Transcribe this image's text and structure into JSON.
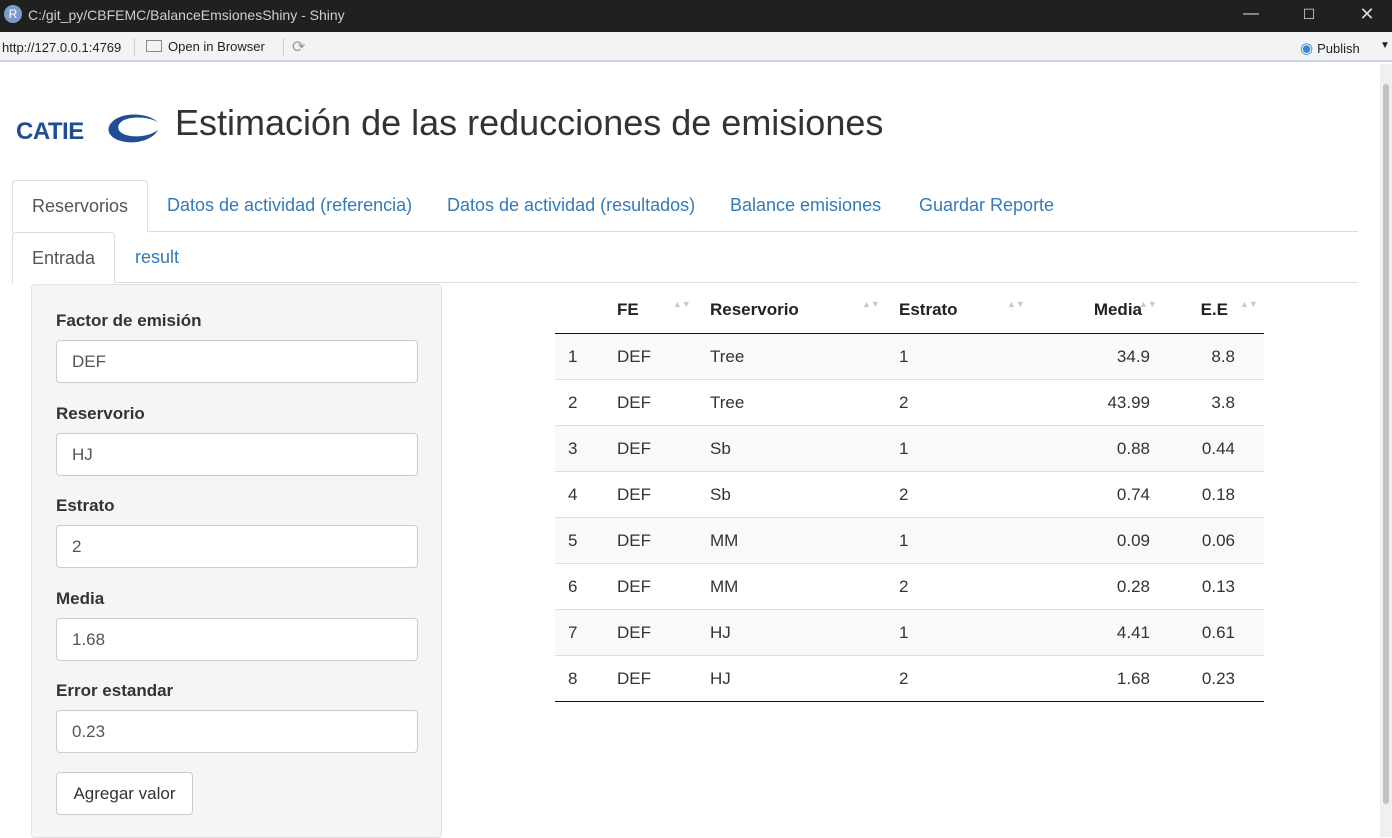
{
  "window": {
    "icon_letter": "R",
    "title": "C:/git_py/CBFEMC/BalanceEmsionesShiny - Shiny",
    "minimize": "—",
    "maximize": "☐",
    "close": "✕"
  },
  "toolbar": {
    "url": "http://127.0.0.1:4769",
    "open_browser": "Open in Browser",
    "refresh": "⟳",
    "publish_icon": "◉",
    "publish": "Publish",
    "dropdown": "▼"
  },
  "header": {
    "logo_text": "CATIE",
    "logo_color": "#1f4e96",
    "title": "Estimación de las reducciones de emisiones"
  },
  "main_tabs": [
    {
      "label": "Reservorios",
      "active": true
    },
    {
      "label": "Datos de actividad (referencia)",
      "active": false
    },
    {
      "label": "Datos de actividad (resultados)",
      "active": false
    },
    {
      "label": "Balance emisiones",
      "active": false
    },
    {
      "label": "Guardar Reporte",
      "active": false
    }
  ],
  "sub_tabs": [
    {
      "label": "Entrada",
      "active": true
    },
    {
      "label": "result",
      "active": false
    }
  ],
  "form": {
    "factor": {
      "label": "Factor de emisión",
      "value": "DEF"
    },
    "reservorio": {
      "label": "Reservorio",
      "value": "HJ"
    },
    "estrato": {
      "label": "Estrato",
      "value": "2"
    },
    "media": {
      "label": "Media",
      "value": "1.68"
    },
    "error": {
      "label": "Error estandar",
      "value": "0.23"
    },
    "submit": "Agregar valor"
  },
  "table": {
    "columns": [
      "",
      "FE",
      "Reservorio",
      "Estrato",
      "Media",
      "E.E"
    ],
    "rows": [
      [
        "1",
        "DEF",
        "Tree",
        "1",
        "34.9",
        "8.8"
      ],
      [
        "2",
        "DEF",
        "Tree",
        "2",
        "43.99",
        "3.8"
      ],
      [
        "3",
        "DEF",
        "Sb",
        "1",
        "0.88",
        "0.44"
      ],
      [
        "4",
        "DEF",
        "Sb",
        "2",
        "0.74",
        "0.18"
      ],
      [
        "5",
        "DEF",
        "MM",
        "1",
        "0.09",
        "0.06"
      ],
      [
        "6",
        "DEF",
        "MM",
        "2",
        "0.28",
        "0.13"
      ],
      [
        "7",
        "DEF",
        "HJ",
        "1",
        "4.41",
        "0.61"
      ],
      [
        "8",
        "DEF",
        "HJ",
        "2",
        "1.68",
        "0.23"
      ]
    ]
  },
  "sort_icon": "▲▼",
  "colors": {
    "link": "#337ab7",
    "titlebar": "#202020"
  }
}
